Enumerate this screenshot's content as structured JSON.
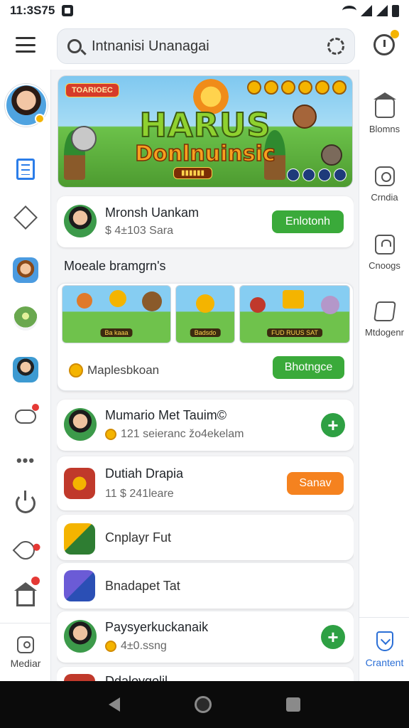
{
  "status_bar": {
    "time": "11:3S75"
  },
  "search": {
    "placeholder": "Intnanisi Unanagai"
  },
  "right_rail": {
    "items": [
      {
        "label": "Blomns",
        "icon": "house-icon"
      },
      {
        "label": "Crndia",
        "icon": "camera-icon"
      },
      {
        "label": "Cnoogs",
        "icon": "lock-icon"
      },
      {
        "label": "Mtdogenr",
        "icon": "edit-icon"
      }
    ],
    "bottom": {
      "label": "Crantent",
      "icon": "shield-icon"
    }
  },
  "left_rail": {
    "bottom": {
      "label": "Mediar",
      "icon": "media-icon"
    }
  },
  "banner": {
    "title_line1": "HARUS",
    "title_line2": "Donlnuinsic",
    "tag": "TOARIOEC"
  },
  "profile_card": {
    "name": "Mronsh Uankam",
    "subtitle": "$ 4±103 Sara",
    "button_label": "Enlotonh"
  },
  "section": {
    "title": "Moeale bramgrn's",
    "thumbs": [
      {
        "label": "Ba kaaa"
      },
      {
        "label": "Badsdo"
      },
      {
        "label": "FUD RUUS SAT"
      }
    ],
    "footer_label": "Maplesbkoan",
    "footer_button": "Bhotngce"
  },
  "list": [
    {
      "title": "Mumario Met Tauim©",
      "subtitle": "121 seieranc žo4ekelam",
      "action": "plus",
      "icon": "person-avatar-icon"
    },
    {
      "title": "Dutiah Drapia",
      "subtitle": "11 $ 241leare",
      "action": "button",
      "button_label": "Sanav",
      "icon": "gift-crate-icon"
    },
    {
      "title": "Cnplayr Fut",
      "subtitle": "",
      "action": "none",
      "icon": "paper-plane-icon"
    },
    {
      "title": "Bnadapet Tat",
      "subtitle": "",
      "action": "none",
      "icon": "gem-icon"
    },
    {
      "title": "Paysyerkuckanaik",
      "subtitle": "4±0.ssng",
      "action": "plus",
      "icon": "person-avatar-icon"
    },
    {
      "title": "Ddaloygolil",
      "subtitle": "",
      "action": "none",
      "icon": "game-icon"
    }
  ]
}
